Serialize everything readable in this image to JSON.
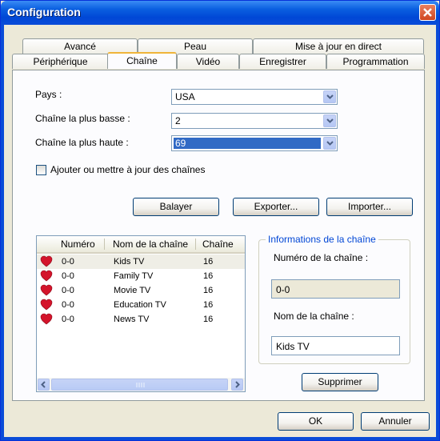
{
  "window": {
    "title": "Configuration"
  },
  "tabs_row1": [
    "Avancé",
    "Peau",
    "Mise à jour en direct"
  ],
  "tabs_row2": [
    "Périphérique",
    "Chaîne",
    "Vidéo",
    "Enregistrer",
    "Programmation"
  ],
  "form": {
    "country_label": "Pays :",
    "country_value": "USA",
    "low_label": "Chaîne la plus basse :",
    "low_value": "2",
    "high_label": "Chaîne la plus haute :",
    "high_value": "69",
    "checkbox_label": "Ajouter ou mettre à jour des chaînes"
  },
  "buttons": {
    "scan": "Balayer",
    "export": "Exporter...",
    "import": "Importer...",
    "delete": "Supprimer",
    "ok": "OK",
    "cancel": "Annuler"
  },
  "list": {
    "columns": [
      "Numéro",
      "Nom de la chaîne",
      "Chaîne"
    ],
    "rows": [
      {
        "number": "0-0",
        "name": "Kids TV",
        "channel": "16"
      },
      {
        "number": "0-0",
        "name": "Family TV",
        "channel": "16"
      },
      {
        "number": "0-0",
        "name": "Movie TV",
        "channel": "16"
      },
      {
        "number": "0-0",
        "name": "Education TV",
        "channel": "16"
      },
      {
        "number": "0-0",
        "name": "News TV",
        "channel": "16"
      }
    ]
  },
  "info": {
    "group_title": "Informations de la chaîne",
    "number_label": "Numéro de la chaîne :",
    "number_value": "0-0",
    "name_label": "Nom de la chaîne :",
    "name_value": "Kids TV"
  },
  "colors": {
    "titlebar": "#0a5fe0",
    "dialog_bg": "#ece9d8",
    "selection": "#316ac5",
    "active_tab_accent": "#f0b53a",
    "group_title": "#0046d5"
  }
}
